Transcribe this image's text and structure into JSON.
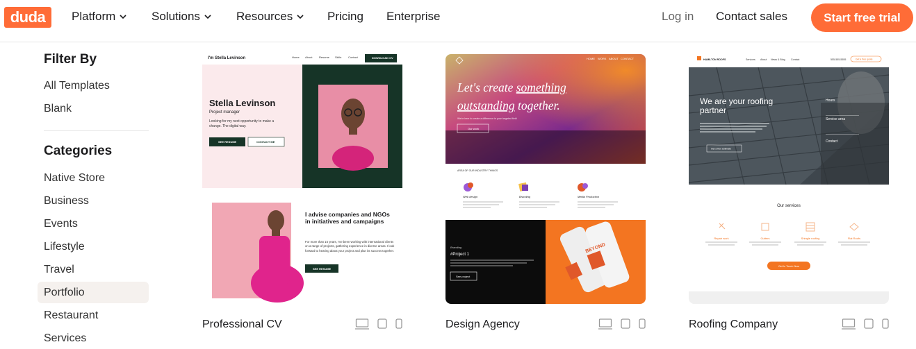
{
  "nav": {
    "logo": "duda",
    "items": [
      "Platform",
      "Solutions",
      "Resources",
      "Pricing",
      "Enterprise"
    ],
    "login": "Log in",
    "contact": "Contact sales",
    "cta": "Start free trial"
  },
  "sidebar": {
    "filter_title": "Filter By",
    "filters": [
      "All Templates",
      "Blank"
    ],
    "categories_title": "Categories",
    "categories": [
      "Native Store",
      "Business",
      "Events",
      "Lifestyle",
      "Travel",
      "Portfolio",
      "Restaurant",
      "Services"
    ],
    "active_category": "Portfolio"
  },
  "templates": [
    {
      "name": "Professional CV",
      "preview": {
        "brand": "I'm Stella Levinson",
        "menu": [
          "Home",
          "About",
          "Resume",
          "Skills",
          "Contact"
        ],
        "download": "DOWNLOAD CV",
        "person": "Stella Levinson",
        "role": "Project manager",
        "intro": "Looking for my next opportunity to make a change. The digital way.",
        "btn_resume": "SEE RESUME",
        "btn_contact": "CONTACT ME",
        "headline2": "I advise companies and NGOs in initiatives and campaigns",
        "body2": "For more than 15 years, I've been working with international clients on a range of projects, gathering experience in diverse areas. I look forward to hearing about your project and plan its success together.",
        "btn_resume2": "SEE RESUME"
      }
    },
    {
      "name": "Design Agency",
      "preview": {
        "menu": [
          "HOME",
          "WORK",
          "ABOUT",
          "CONTACT"
        ],
        "hero_lead": "Let's create ",
        "hero_u1": "something",
        "hero_u2": "outstanding",
        "hero_end": " together.",
        "hero_sub": "We're here to create a difference in your targeted field",
        "hero_btn": "Our work",
        "section_title": "AREA OF OUR INDUSTRY THINGS",
        "services": [
          "Web design",
          "Branding",
          "Media Production"
        ],
        "project_tag": "Branding",
        "project_title": "#Project 1",
        "project_btn": "See project",
        "can_text": "BEYOND"
      }
    },
    {
      "name": "Roofing Company",
      "preview": {
        "brand": "HAMILTON ROOFS",
        "menu": [
          "Services",
          "About",
          "News & Blog",
          "Contact"
        ],
        "phone": "555-555-5555",
        "quote_btn": "Get a free quote",
        "hero": "We are your roofing partner",
        "hero_btn": "Get a free estimate",
        "info": [
          "Hours",
          "Service area",
          "Contact"
        ],
        "services_title": "Our services",
        "services": [
          "Repair work",
          "Gutters",
          "Shingle roofing",
          "Flat Roofs"
        ],
        "services_btn": "Get In Touch Now"
      }
    }
  ]
}
